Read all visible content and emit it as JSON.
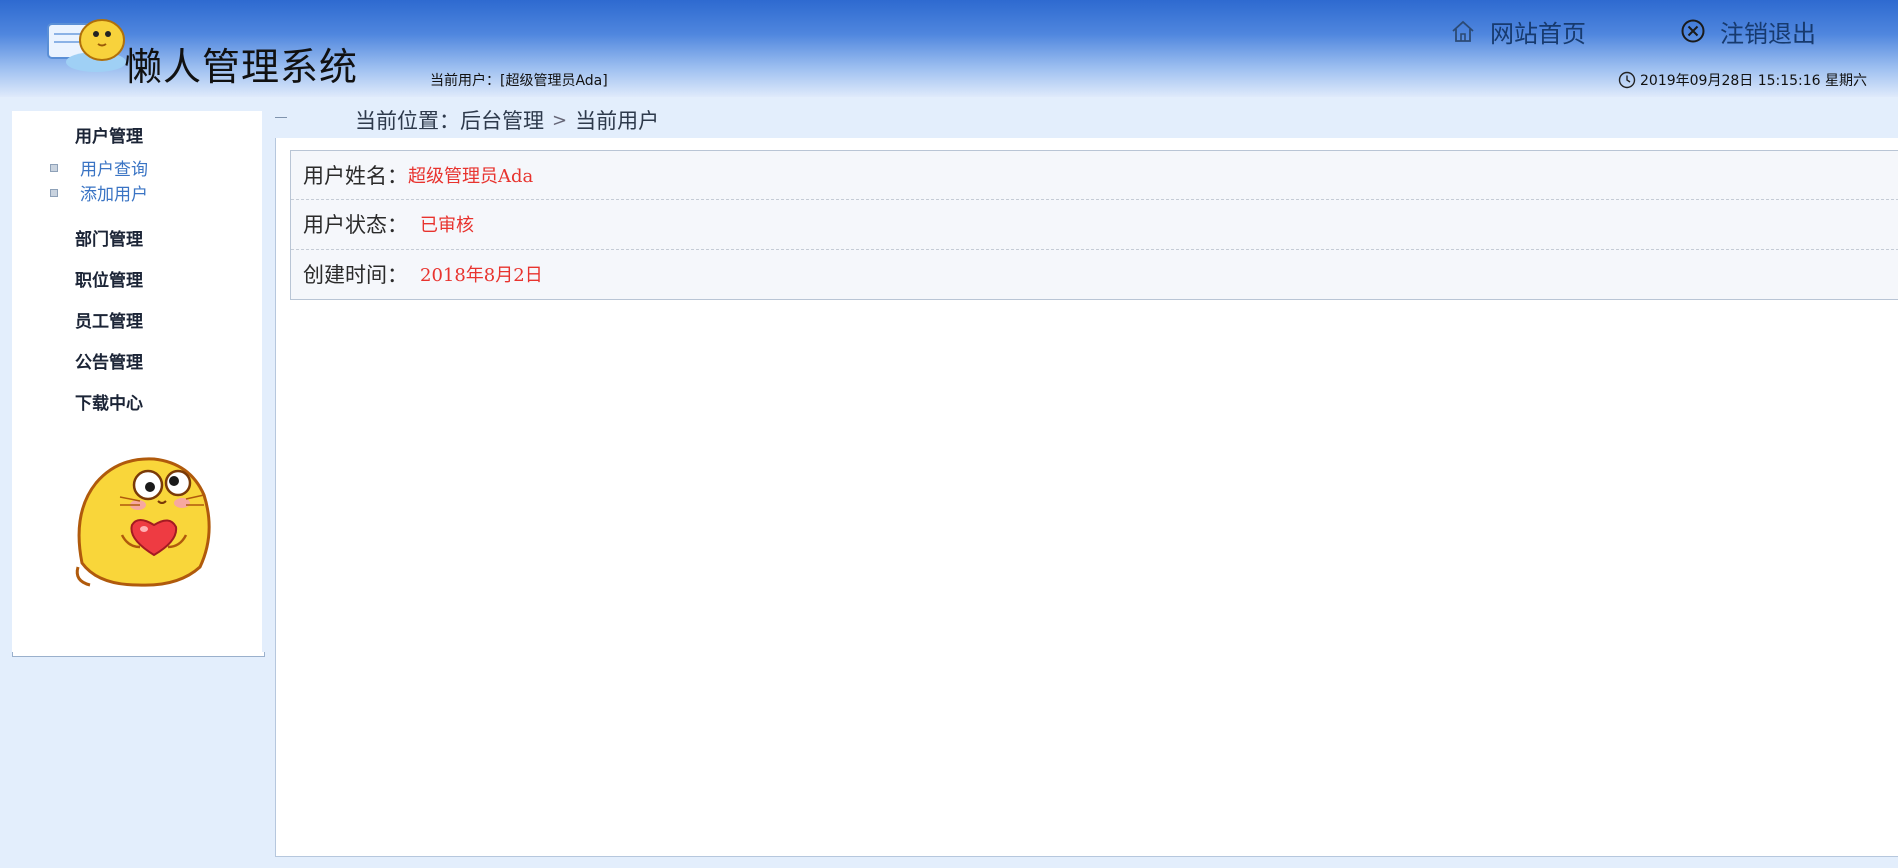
{
  "header": {
    "app_title": "懒人管理系统",
    "current_user_text": "当前用户：[超级管理员Ada]",
    "nav_home": "网站首页",
    "nav_logout": "注销退出",
    "datetime": "2019年09月28日 15:15:16 星期六"
  },
  "sidebar": {
    "user_management": "用户管理",
    "user_query": "用户查询",
    "add_user": "添加用户",
    "department_management": "部门管理",
    "position_management": "职位管理",
    "employee_management": "员工管理",
    "notice_management": "公告管理",
    "download_center": "下载中心"
  },
  "breadcrumb": {
    "prefix": "当前位置：",
    "level1": "后台管理",
    "separator": ">",
    "level2": "当前用户"
  },
  "user_info": {
    "name_label": "用户姓名：",
    "name_value": "超级管理员Ada",
    "status_label": "用户状态：",
    "status_value": "已审核",
    "created_label": "创建时间：",
    "created_value": "2018年8月2日"
  },
  "colors": {
    "header_top": "#2e6ad0",
    "page_bg": "#e3eefc",
    "value_red": "#e8332e",
    "submenu_blue": "#3a74c4"
  }
}
